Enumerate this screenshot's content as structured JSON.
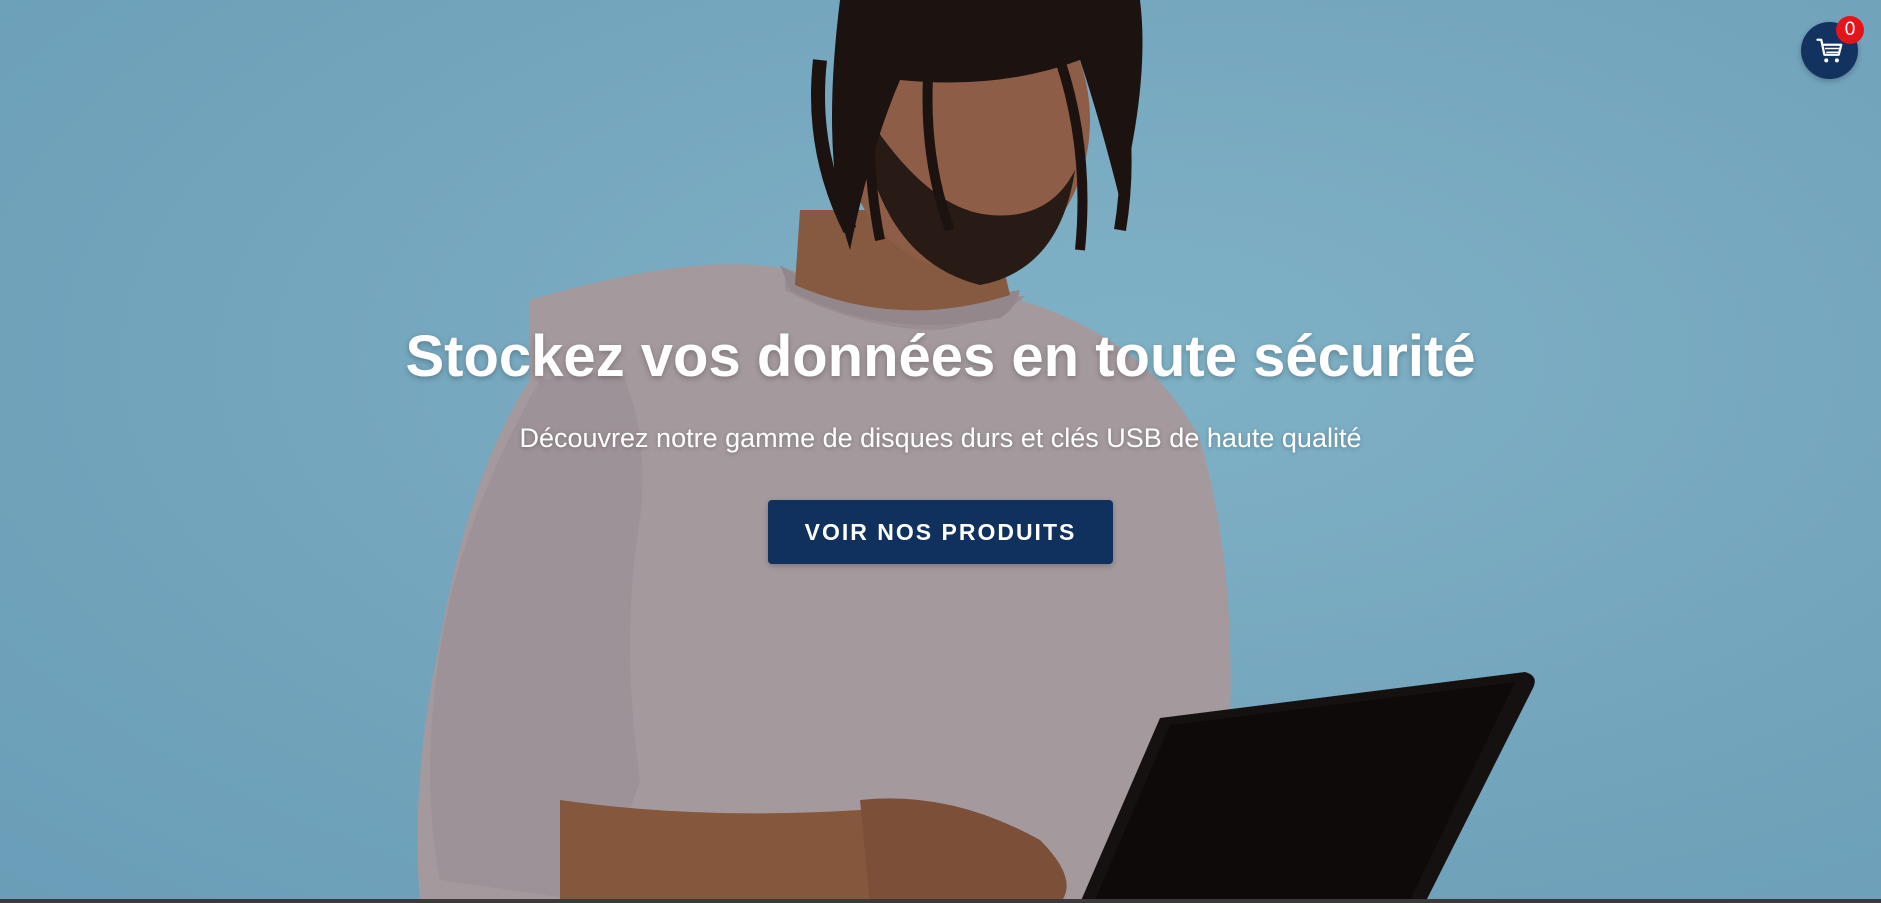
{
  "hero": {
    "title": "Stockez vos données en toute sécurité",
    "subtitle": "Découvrez notre gamme de disques durs et clés USB de haute qualité",
    "cta_label": "VOIR NOS PRODUITS"
  },
  "cart": {
    "count": "0",
    "icon": "shopping-cart-icon"
  },
  "colors": {
    "background": "#7aafc6",
    "button": "#10305e",
    "badge": "#e4141b",
    "text": "#ffffff"
  }
}
